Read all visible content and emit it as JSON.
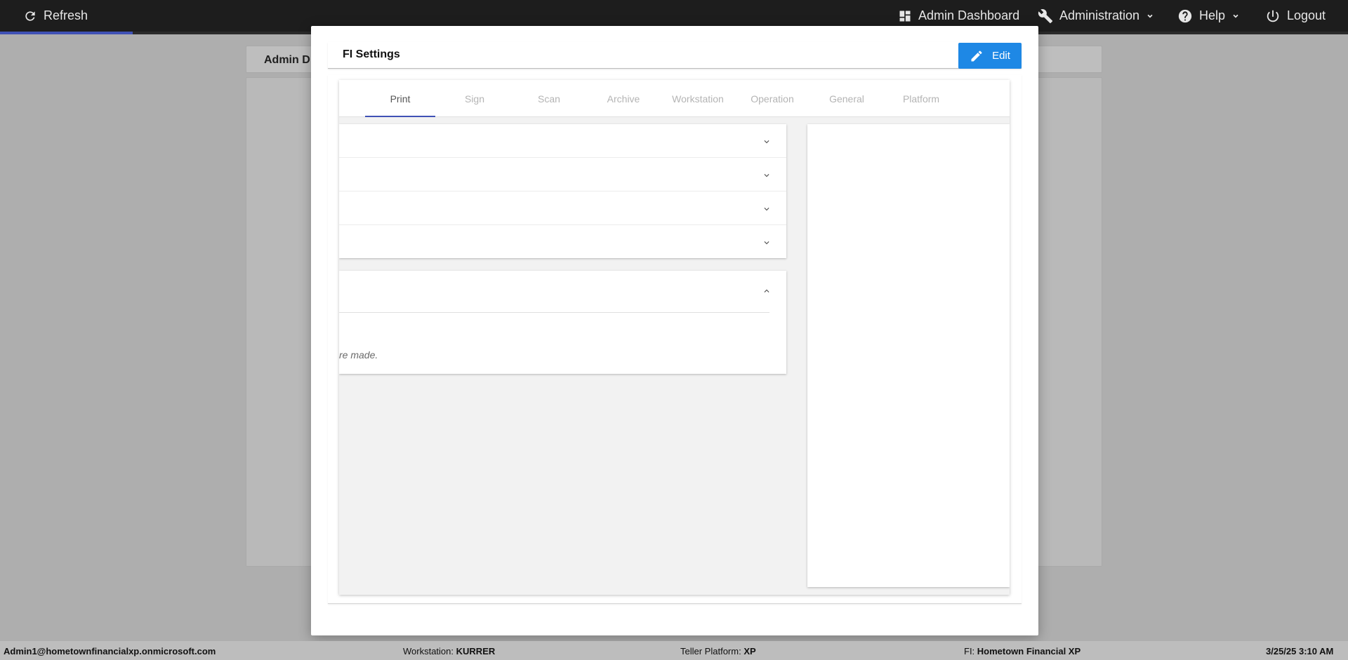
{
  "topbar": {
    "refresh_label": "Refresh",
    "admin_dashboard_label": "Admin Dashboard",
    "administration_label": "Administration",
    "help_label": "Help",
    "logout_label": "Logout",
    "accent_color": "#3f51b5"
  },
  "background": {
    "header_title": "Admin D"
  },
  "modal": {
    "title": "FI Settings",
    "edit_label": "Edit",
    "edit_color": "#1e88e5",
    "tabs": [
      "Print",
      "Sign",
      "Scan",
      "Archive",
      "Workstation",
      "Operation",
      "General",
      "Platform"
    ],
    "active_tab": "Print",
    "note_text": "re made."
  },
  "footer": {
    "user": "Admin1@hometownfinancialxp.onmicrosoft.com",
    "workstation_label": "Workstation:",
    "workstation_value": "KURRER",
    "platform_label": "Teller Platform:",
    "platform_value": "XP",
    "fi_label": "FI:",
    "fi_value": "Hometown Financial XP",
    "datetime": "3/25/25 3:10 AM"
  }
}
